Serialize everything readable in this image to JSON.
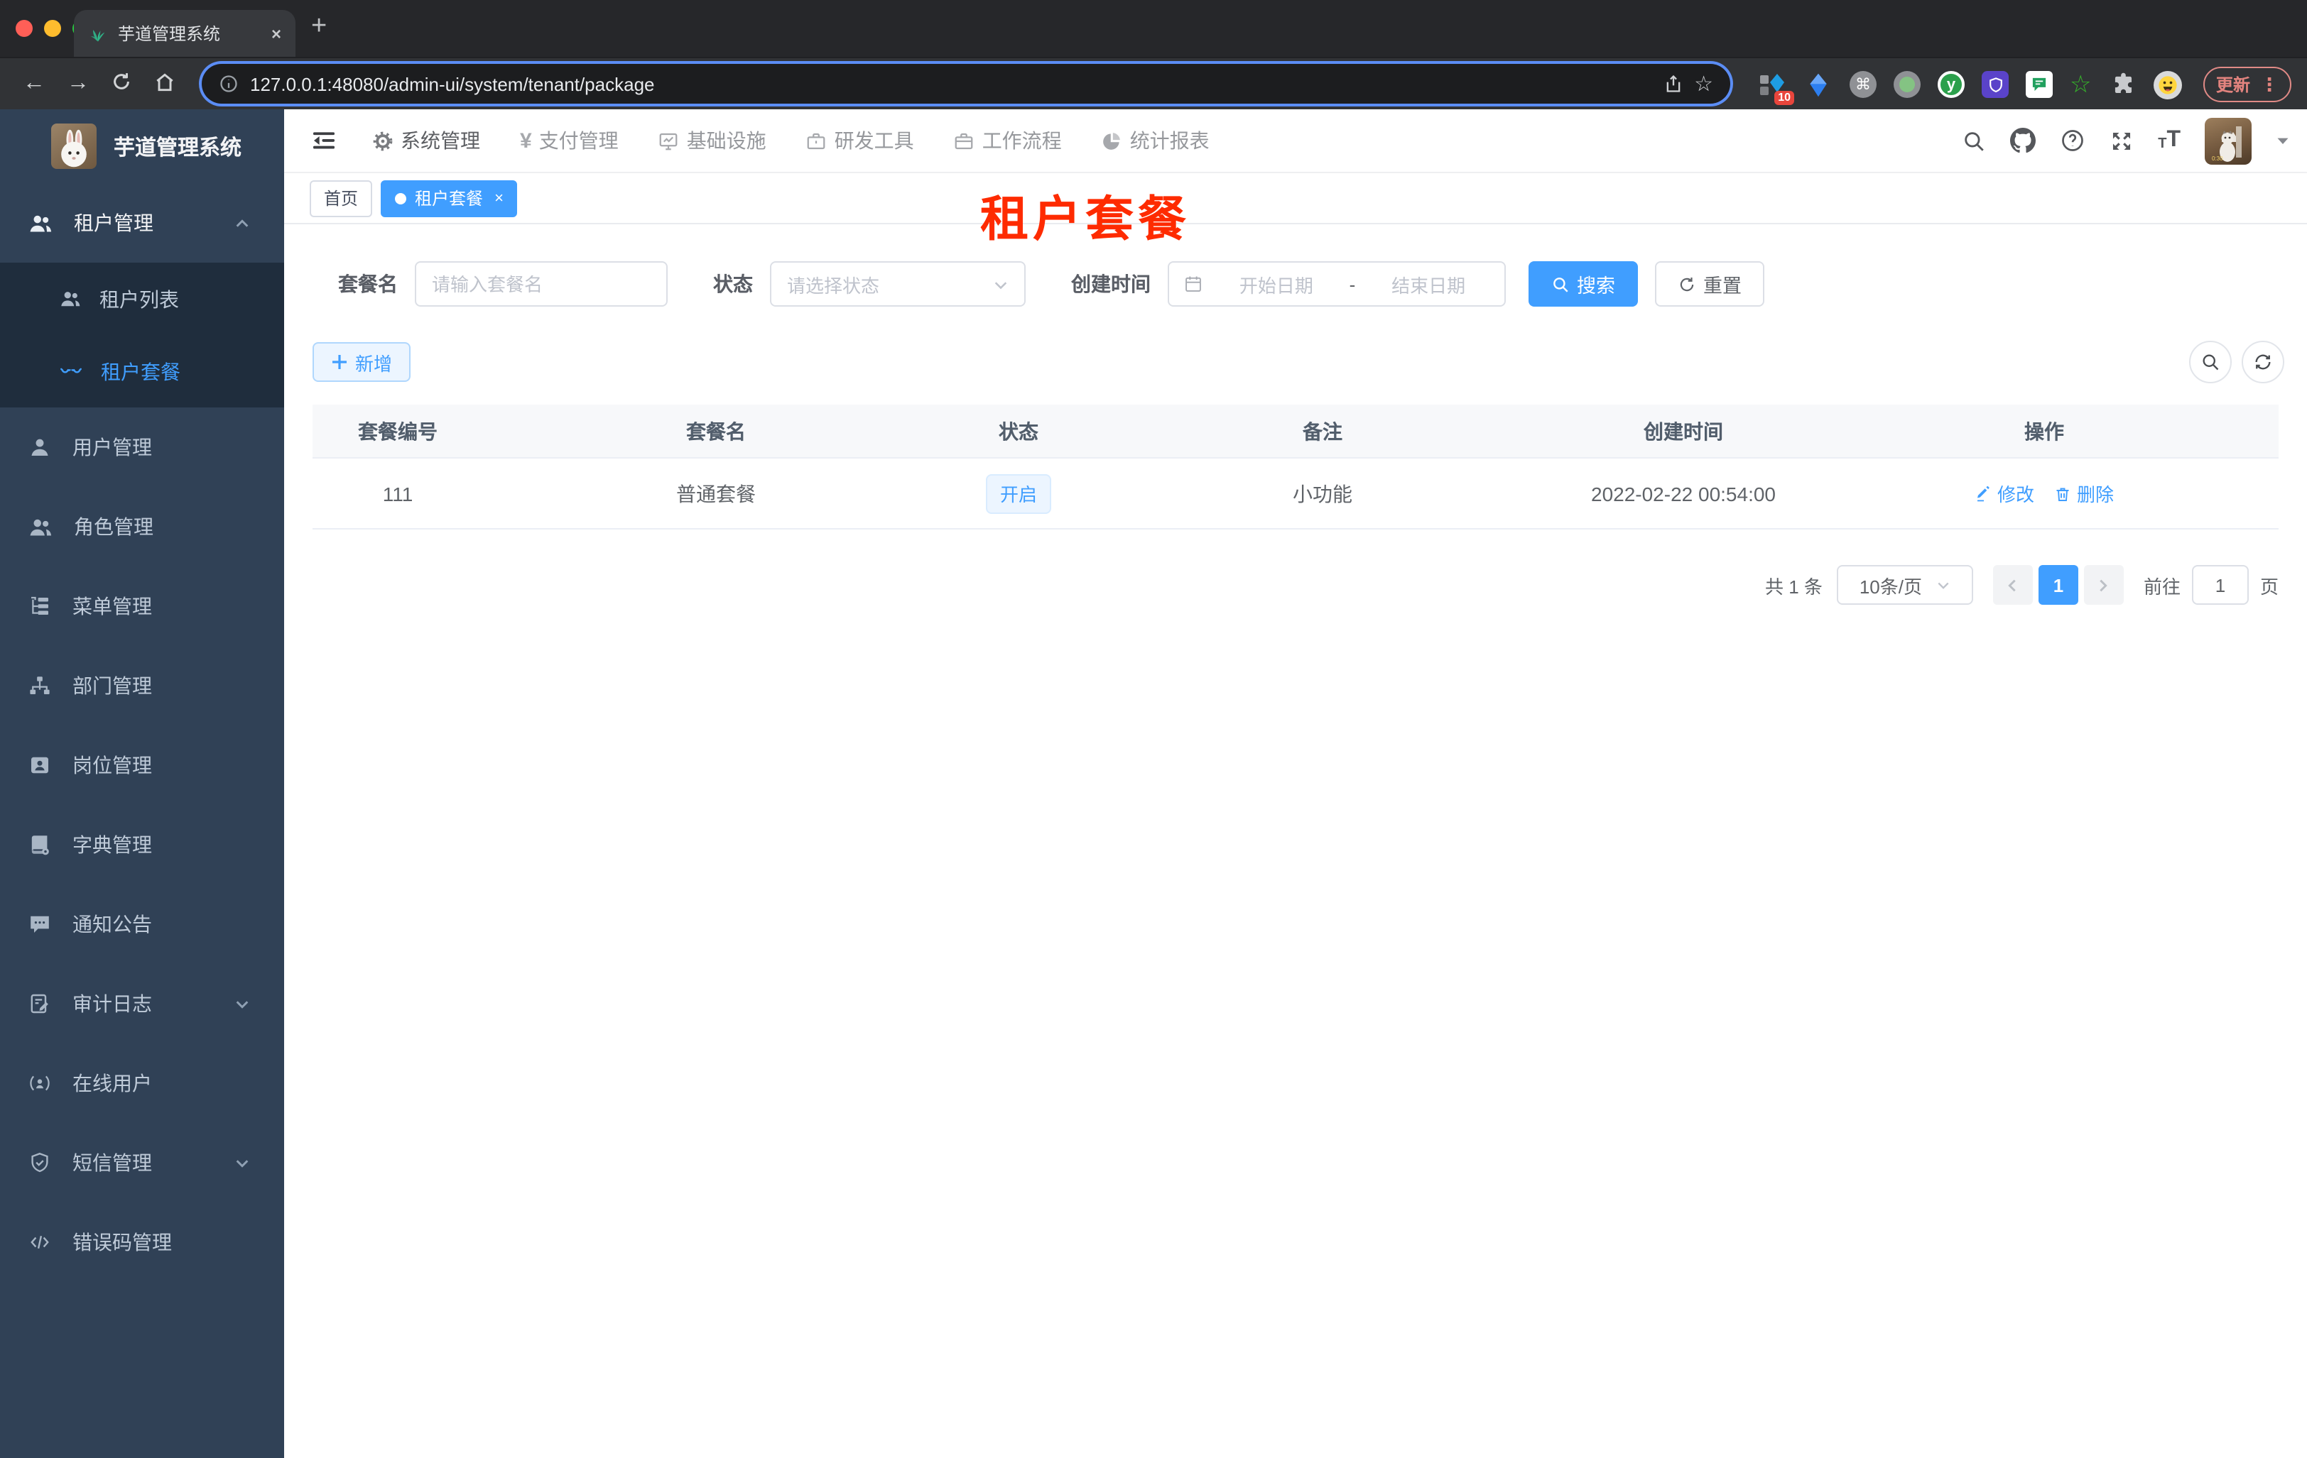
{
  "browser": {
    "tab_title": "芋道管理系统",
    "url": "127.0.0.1:48080/admin-ui/system/tenant/package",
    "extensions_badge": "10",
    "update_label": "更新"
  },
  "icons": {
    "close": "×",
    "new_tab": "+",
    "star": "☆",
    "command": "⌘",
    "kebab": "⋮",
    "yen": "¥",
    "y_letter": "y",
    "question": "?"
  },
  "sidebar": {
    "title": "芋道管理系统",
    "items": [
      {
        "label": "租户管理"
      },
      {
        "label": "租户列表"
      },
      {
        "label": "租户套餐"
      },
      {
        "label": "用户管理"
      },
      {
        "label": "角色管理"
      },
      {
        "label": "菜单管理"
      },
      {
        "label": "部门管理"
      },
      {
        "label": "岗位管理"
      },
      {
        "label": "字典管理"
      },
      {
        "label": "通知公告"
      },
      {
        "label": "审计日志"
      },
      {
        "label": "在线用户"
      },
      {
        "label": "短信管理"
      },
      {
        "label": "错误码管理"
      }
    ]
  },
  "topnav": {
    "items": [
      {
        "label": "系统管理"
      },
      {
        "label": "支付管理"
      },
      {
        "label": "基础设施"
      },
      {
        "label": "研发工具"
      },
      {
        "label": "工作流程"
      },
      {
        "label": "统计报表"
      }
    ]
  },
  "tags": {
    "home": "首页",
    "active": "租户套餐"
  },
  "overlay_title": "租户套餐",
  "filters": {
    "name_label": "套餐名",
    "name_placeholder": "请输入套餐名",
    "status_label": "状态",
    "status_placeholder": "请选择状态",
    "date_label": "创建时间",
    "date_start": "开始日期",
    "date_separator": "-",
    "date_end": "结束日期",
    "search_label": "搜索",
    "reset_label": "重置"
  },
  "toolbar": {
    "add_label": "新增"
  },
  "table": {
    "headers": [
      "套餐编号",
      "套餐名",
      "状态",
      "备注",
      "创建时间",
      "操作"
    ],
    "rows": [
      {
        "id": "111",
        "name": "普通套餐",
        "status": "开启",
        "remark": "小功能",
        "created": "2022-02-22 00:54:00",
        "edit": "修改",
        "delete": "删除"
      }
    ]
  },
  "pagination": {
    "total": "共 1 条",
    "page_size": "10条/页",
    "current_page": "1",
    "jump_prefix": "前往",
    "jump_value": "1",
    "jump_suffix": "页"
  },
  "colors": {
    "primary": "#409eff",
    "annotation_red": "#fe2b00",
    "sidebar_bg": "#304156",
    "submenu_bg": "#1f2d3d"
  }
}
